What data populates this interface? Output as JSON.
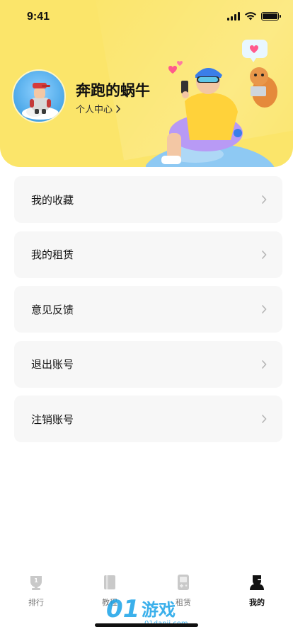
{
  "status_bar": {
    "time": "9:41",
    "signal-icon": "signal-bars",
    "wifi-icon": "wifi",
    "battery-icon": "battery-full"
  },
  "profile": {
    "username": "奔跑的蜗牛",
    "link_label": "个人中心",
    "avatar_icon": "avatar-cartoon"
  },
  "menu": {
    "items": [
      {
        "label": "我的收藏"
      },
      {
        "label": "我的租赁"
      },
      {
        "label": "意见反馈"
      },
      {
        "label": "退出账号"
      },
      {
        "label": "注销账号"
      }
    ]
  },
  "tabbar": {
    "items": [
      {
        "label": "排行",
        "icon": "ranking-icon",
        "active": false
      },
      {
        "label": "教程",
        "icon": "book-icon",
        "active": false
      },
      {
        "label": "租赁",
        "icon": "gameboy-icon",
        "active": false
      },
      {
        "label": "我的",
        "icon": "user-icon",
        "active": true
      }
    ]
  },
  "watermark": {
    "text": "01danji.com",
    "logo_text": "游戏"
  },
  "colors": {
    "header_bg": "#fbe56a",
    "card_bg": "#f7f7f7",
    "accent": "#111111"
  }
}
